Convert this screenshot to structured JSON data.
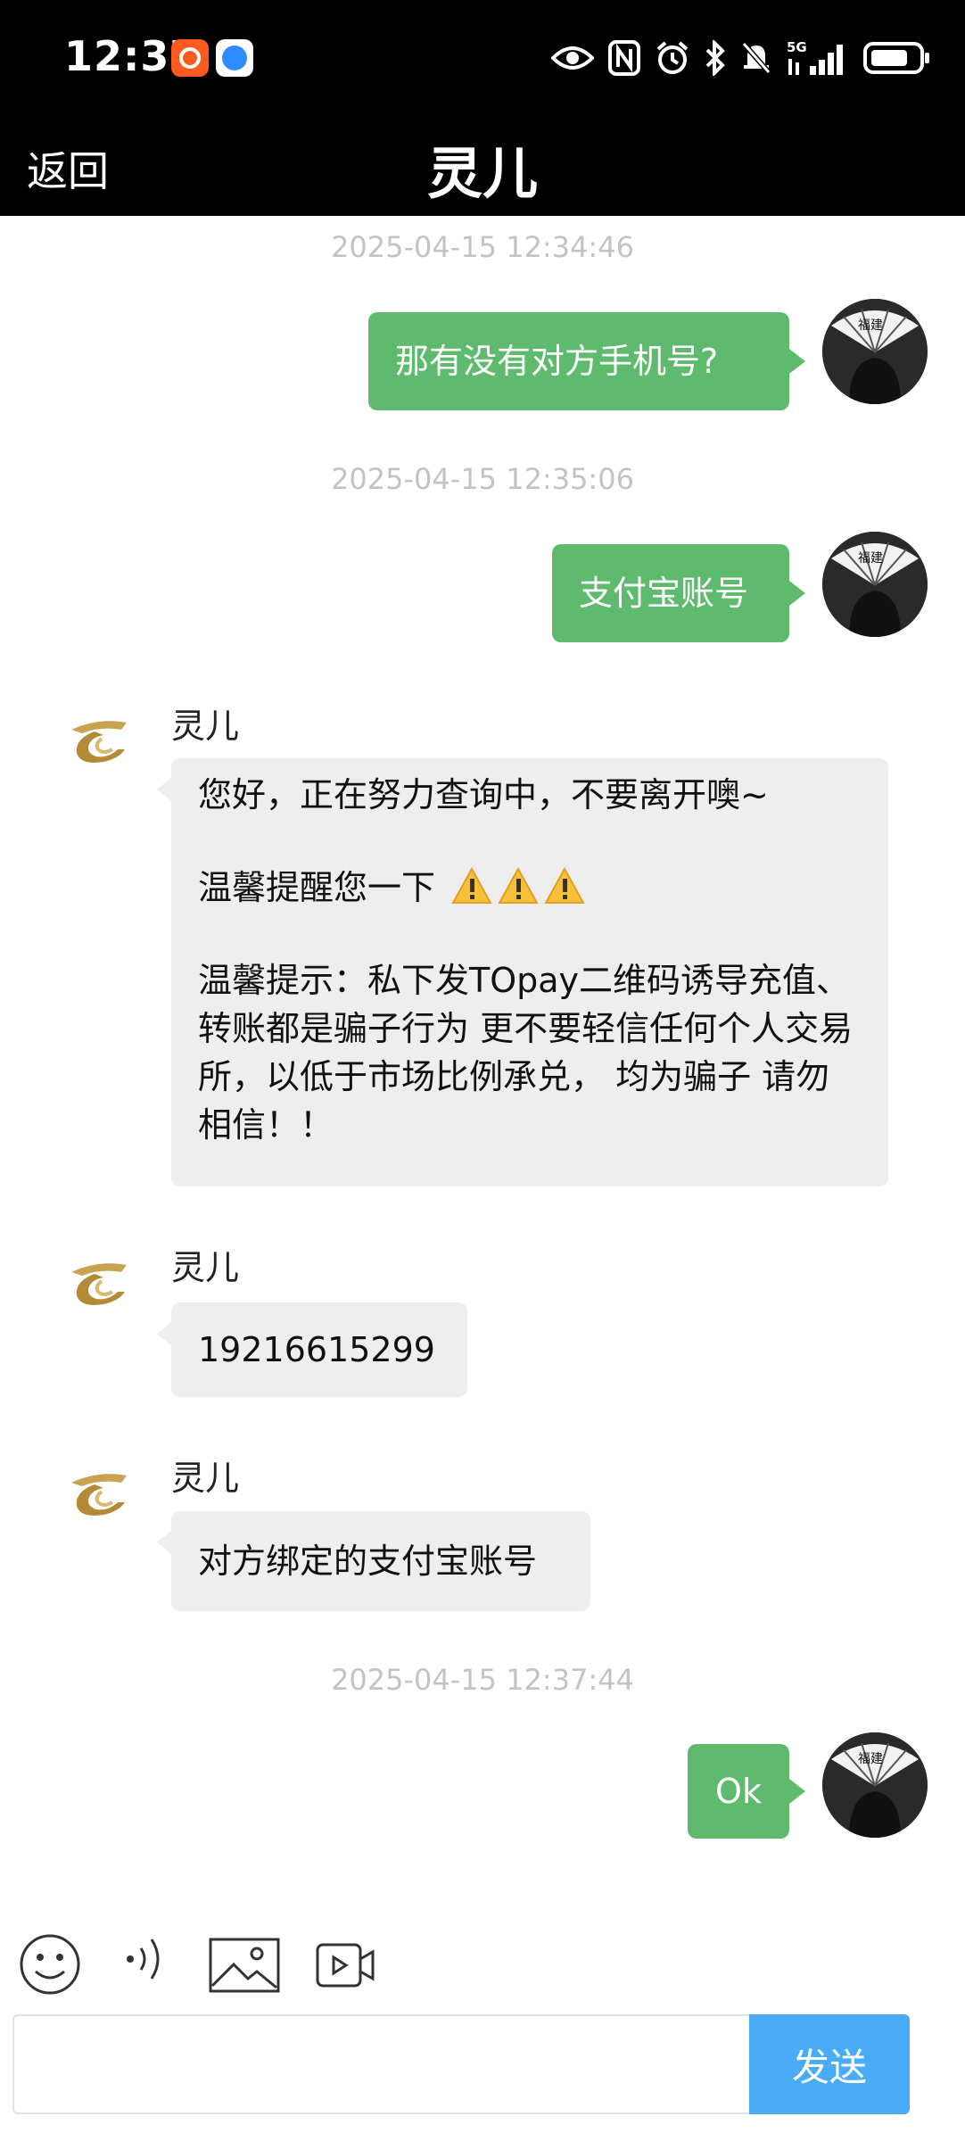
{
  "status_bar": {
    "time": "12:37",
    "network": "5G",
    "icons": [
      "app-badge-orange",
      "app-badge-blue",
      "eye-icon",
      "nfc-icon",
      "alarm-icon",
      "bluetooth-icon",
      "mute-icon",
      "signal-icon",
      "battery-icon"
    ]
  },
  "nav": {
    "back_label": "返回",
    "title": "灵儿"
  },
  "messages": {
    "m1": {
      "timestamp": "2025-04-15 12:34:46",
      "text": "那有没有对方手机号?"
    },
    "m2": {
      "timestamp": "2025-04-15 12:35:06",
      "text": "支付宝账号"
    },
    "m3": {
      "sender": "灵儿",
      "line1": "您好，正在努力查询中，不要离开噢~",
      "line2": "温馨提醒您一下",
      "line3": "温馨提示：私下发TOpay二维码诱导充值、转账都是骗子行为   更不要轻信任何个人交易所，以低于市场比例承兑， 均为骗子 请勿相信！！"
    },
    "m4": {
      "sender": "灵儿",
      "text": "19216615299"
    },
    "m5": {
      "sender": "灵儿",
      "text": "对方绑定的支付宝账号"
    },
    "m6": {
      "timestamp": "2025-04-15 12:37:44",
      "text": "Ok"
    }
  },
  "toolbar": {
    "icons": [
      "emoji-icon",
      "voice-icon",
      "image-icon",
      "video-icon"
    ]
  },
  "composer": {
    "placeholder": "",
    "value": "",
    "send_label": "发送"
  },
  "colors": {
    "outgoing_bubble": "#5ebb6e",
    "incoming_bubble": "#eeeeee",
    "send_button": "#4aacf7",
    "header": "#000000",
    "timestamp": "#c3c3c3"
  }
}
